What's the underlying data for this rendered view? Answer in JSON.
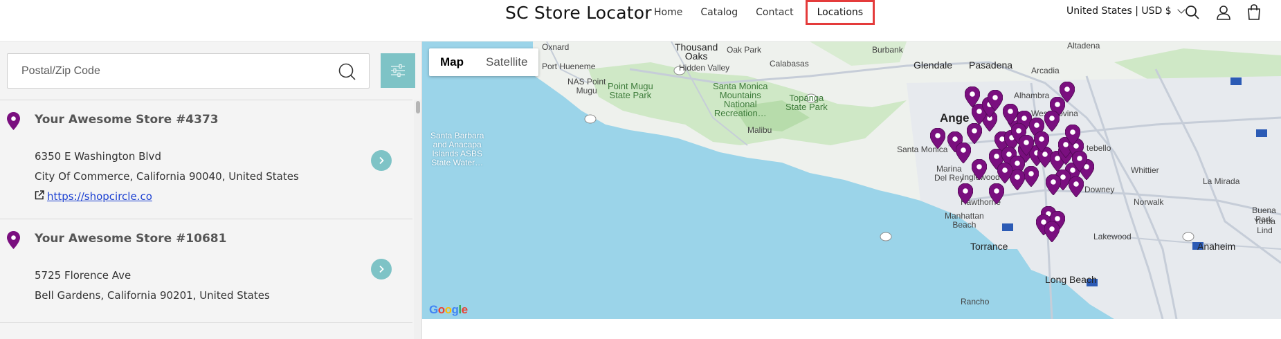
{
  "header": {
    "brand": "SC Store Locator",
    "nav": [
      "Home",
      "Catalog",
      "Contact",
      "Locations"
    ],
    "active_nav": "Locations",
    "country": "United States | USD $",
    "icons": [
      "search-icon",
      "account-icon",
      "cart-icon"
    ]
  },
  "search": {
    "placeholder": "Postal/Zip Code"
  },
  "stores": [
    {
      "name": "Your Awesome Store #4373",
      "address1": "6350 E Washington Blvd",
      "address2": "City Of Commerce, California 90040, United States",
      "website": "https://shopcircle.co"
    },
    {
      "name": "Your Awesome Store #10681",
      "address1": "5725 Florence Ave",
      "address2": "Bell Gardens, California 90201, United States"
    }
  ],
  "map": {
    "type_buttons": [
      "Map",
      "Satellite"
    ],
    "selected_type": "Map",
    "labels": {
      "oxnard": "Oxnard",
      "thousand_oaks": "Thousand\nOaks",
      "oak_park": "Oak Park",
      "burbank": "Burbank",
      "altadena": "Altadena",
      "port_hueneme": "Port Hueneme",
      "hidden_valley": "Hidden Valley",
      "calabasas": "Calabasas",
      "glendale": "Glendale",
      "pasadena": "Pasadena",
      "arcadia": "Arcadia",
      "nas_point_mugu": "NAS Point\nMugu",
      "point_mugu_sp": "Point Mugu\nState Park",
      "santa_monica_mountains": "Santa Monica\nMountains\nNational\nRecreation…",
      "topanga": "Topanga\nState Park",
      "alhambra": "Alhambra",
      "west_covina": "West Covina",
      "malibu": "Malibu",
      "los_angeles": "Ange",
      "santa_barbara": "Santa Barbara\nand Anacapa\nIslands ASBS\nState Water…",
      "santa_monica": "Santa Monica",
      "marina": "Marina\nDel Rey",
      "inglewood": "Inglewood",
      "montebello": "tebello",
      "whittier": "Whittier",
      "downey": "Downey",
      "hawthorne": "Hawthorne",
      "norwalk": "Norwalk",
      "manhattan_beach": "Manhattan\nBeach",
      "la_mirada": "La Mirada",
      "torrance": "Torrance",
      "lakewood": "Lakewood",
      "anaheim": "Anaheim",
      "long_beach": "Long Beach",
      "rancho": "Rancho",
      "buena": "Buena Park",
      "yorba": "Yorba Lind"
    },
    "attribution": "Google",
    "pin_color": "#7a0f7f",
    "marker_count": 48
  },
  "colors": {
    "accent_teal": "#7ec3c6",
    "active_outline": "#e43b3b",
    "link": "#1a3fd1",
    "water": "#9bd4e9",
    "land": "#eef1ed"
  }
}
